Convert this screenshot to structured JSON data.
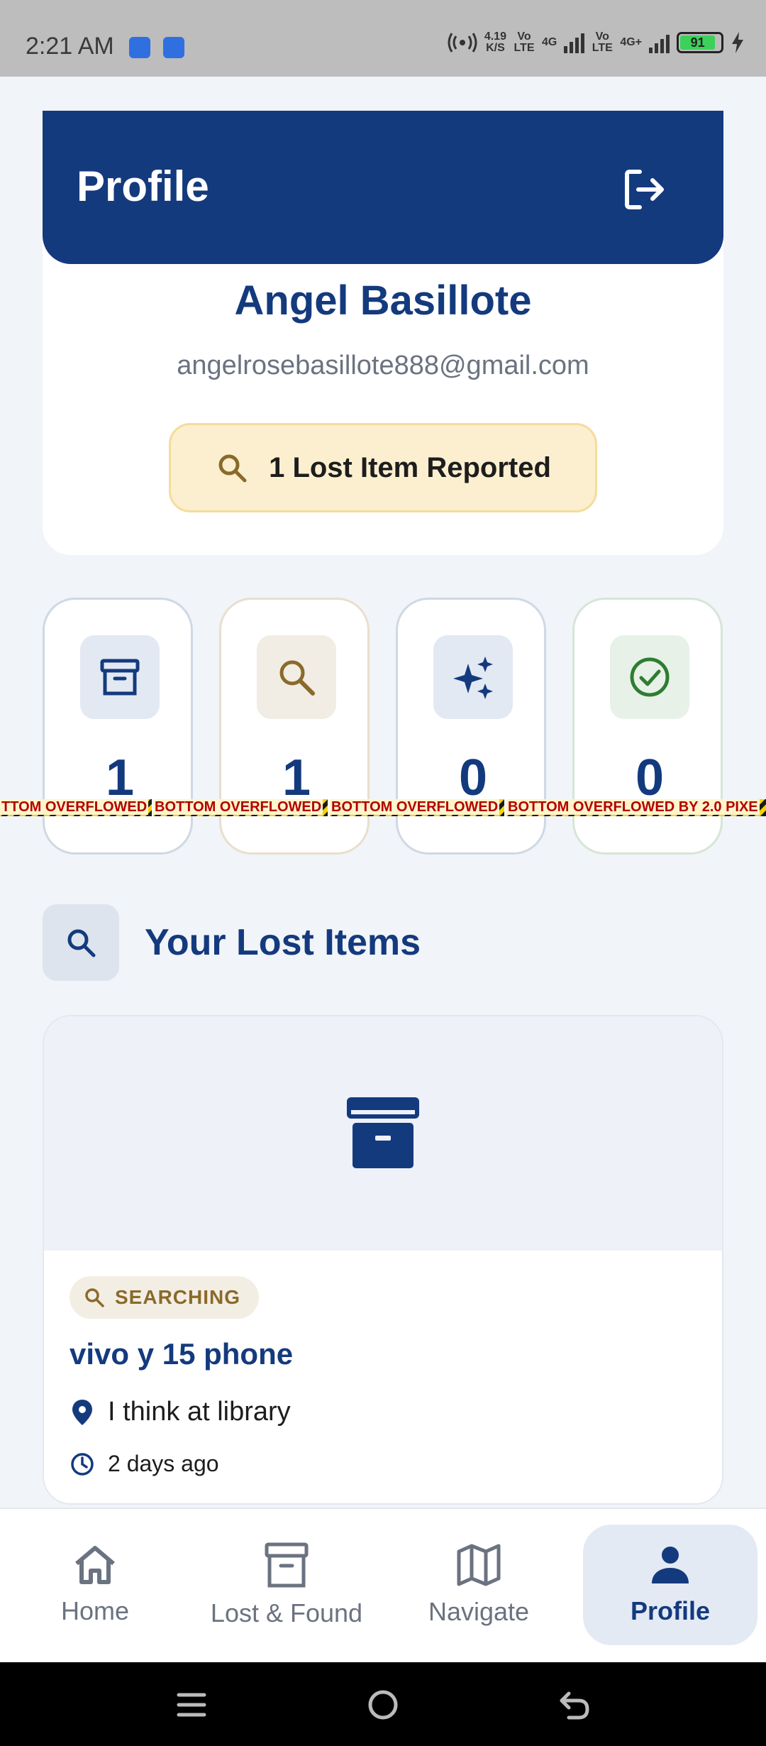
{
  "status_bar": {
    "time": "2:21 AM",
    "net_speed_top": "4.19",
    "net_speed_bottom": "K/S",
    "volte_1": "Vo LTE",
    "net_1": "4G",
    "volte_2": "Vo LTE",
    "net_2": "4G+",
    "battery": "91"
  },
  "header": {
    "title": "Profile",
    "logout_icon": "logout-icon"
  },
  "profile": {
    "name": "Angel Basillote",
    "email": "angelrosebasillote888@gmail.com",
    "lost_badge": "1 Lost Item Reported"
  },
  "stats": [
    {
      "icon": "archive-icon",
      "value": "1",
      "icon_bg": "#e3e9f2",
      "icon_color": "#143a7e"
    },
    {
      "icon": "search-icon",
      "value": "1",
      "icon_bg": "#f1ece4",
      "icon_color": "#8a6a2a"
    },
    {
      "icon": "sparkle-icon",
      "value": "0",
      "icon_bg": "#e3e9f2",
      "icon_color": "#143a7e"
    },
    {
      "icon": "check-circle-icon",
      "value": "0",
      "icon_bg": "#e7f1e7",
      "icon_color": "#2e7d32"
    }
  ],
  "overflow_warnings": [
    "TTOM OVERFLOWED",
    "BOTTOM OVERFLOWED",
    "BOTTOM OVERFLOWED",
    "BOTTOM OVERFLOWED BY 2.0 PIXE"
  ],
  "section": {
    "title": "Your Lost Items"
  },
  "lost_item": {
    "status": "SEARCHING",
    "title": "vivo y 15 phone",
    "location": "I think at library",
    "time": "2 days ago"
  },
  "bottom_nav": [
    {
      "label": "Home",
      "icon": "home-icon"
    },
    {
      "label": "Lost & Found",
      "icon": "archive-icon"
    },
    {
      "label": "Navigate",
      "icon": "map-icon"
    },
    {
      "label": "Profile",
      "icon": "person-icon",
      "active": true
    }
  ],
  "colors": {
    "primary": "#143a7e",
    "background": "#f1f4f8",
    "badge_bg": "#fcefcf",
    "searching": "#8a6a2a"
  }
}
